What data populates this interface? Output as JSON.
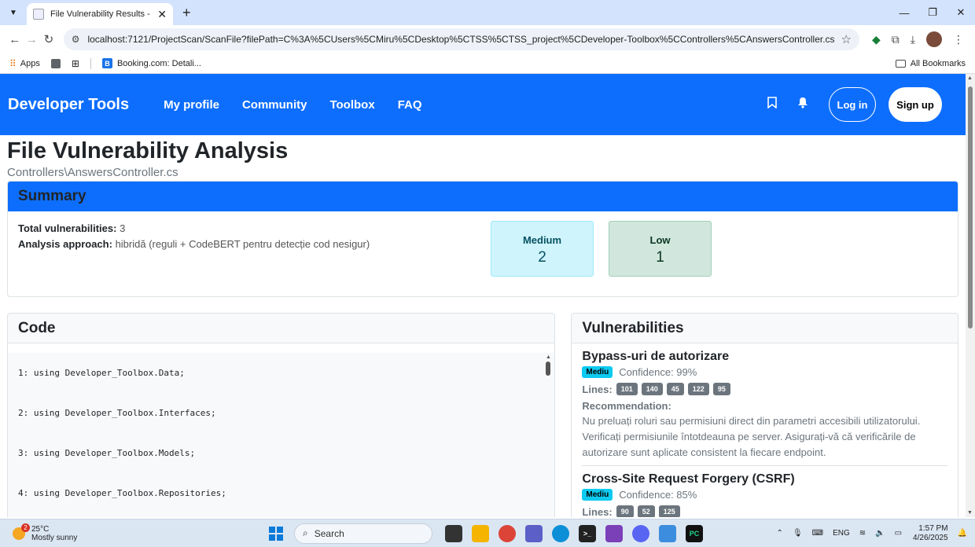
{
  "browser": {
    "tab_title": "File Vulnerability Results - Deve",
    "url": "localhost:7121/ProjectScan/ScanFile?filePath=C%3A%5CUsers%5CMiru%5CDesktop%5CTSS%5CTSS_project%5CDeveloper-Toolbox%5CControllers%5CAnswersController.cs",
    "bookmarks": {
      "apps": "Apps",
      "booking": "Booking.com: Detali...",
      "all": "All Bookmarks"
    }
  },
  "navbar": {
    "brand": "Developer Tools",
    "links": [
      "My profile",
      "Community",
      "Toolbox",
      "FAQ"
    ],
    "login": "Log in",
    "signup": "Sign up"
  },
  "page": {
    "title": "File Vulnerability Analysis",
    "file": "Controllers\\AnswersController.cs"
  },
  "summary": {
    "heading": "Summary",
    "total_label": "Total vulnerabilities:",
    "total_value": "3",
    "approach_label": "Analysis approach:",
    "approach_value": "hibridă (reguli + CodeBERT pentru detecție cod nesigur)",
    "medium_label": "Medium",
    "medium_count": "2",
    "low_label": "Low",
    "low_count": "1"
  },
  "code": {
    "heading": "Code",
    "lines": [
      "1: using Developer_Toolbox.Data;",
      "2: using Developer_Toolbox.Interfaces;",
      "3: using Developer_Toolbox.Models;",
      "4: using Developer_Toolbox.Repositories;"
    ]
  },
  "vulnerabilities": {
    "heading": "Vulnerabilities",
    "lines_label": "Lines:",
    "rec_label": "Recommendation:",
    "items": [
      {
        "title": "Bypass-uri de autorizare",
        "severity": "Mediu",
        "confidence": "Confidence: 99%",
        "lines": [
          "101",
          "140",
          "45",
          "122",
          "95"
        ],
        "recommendation": "Nu preluați roluri sau permisiuni direct din parametri accesibili utilizatorului. Verificați permisiunile întotdeauna pe server. Asigurați-vă că verificările de autorizare sunt aplicate consistent la fiecare endpoint."
      },
      {
        "title": "Cross-Site Request Forgery (CSRF)",
        "severity": "Mediu",
        "confidence": "Confidence: 85%",
        "lines": [
          "90",
          "52",
          "125"
        ]
      }
    ]
  },
  "taskbar": {
    "temp": "25°C",
    "weather": "Mostly sunny",
    "weather_badge": "2",
    "search": "Search",
    "lang": "ENG",
    "time": "1:57 PM",
    "date": "4/26/2025"
  },
  "colors": {
    "primary": "#0d6efd",
    "medium_bg": "#cff4fc",
    "low_bg": "#d1e7dd",
    "badge_info": "#0dcaf0"
  }
}
